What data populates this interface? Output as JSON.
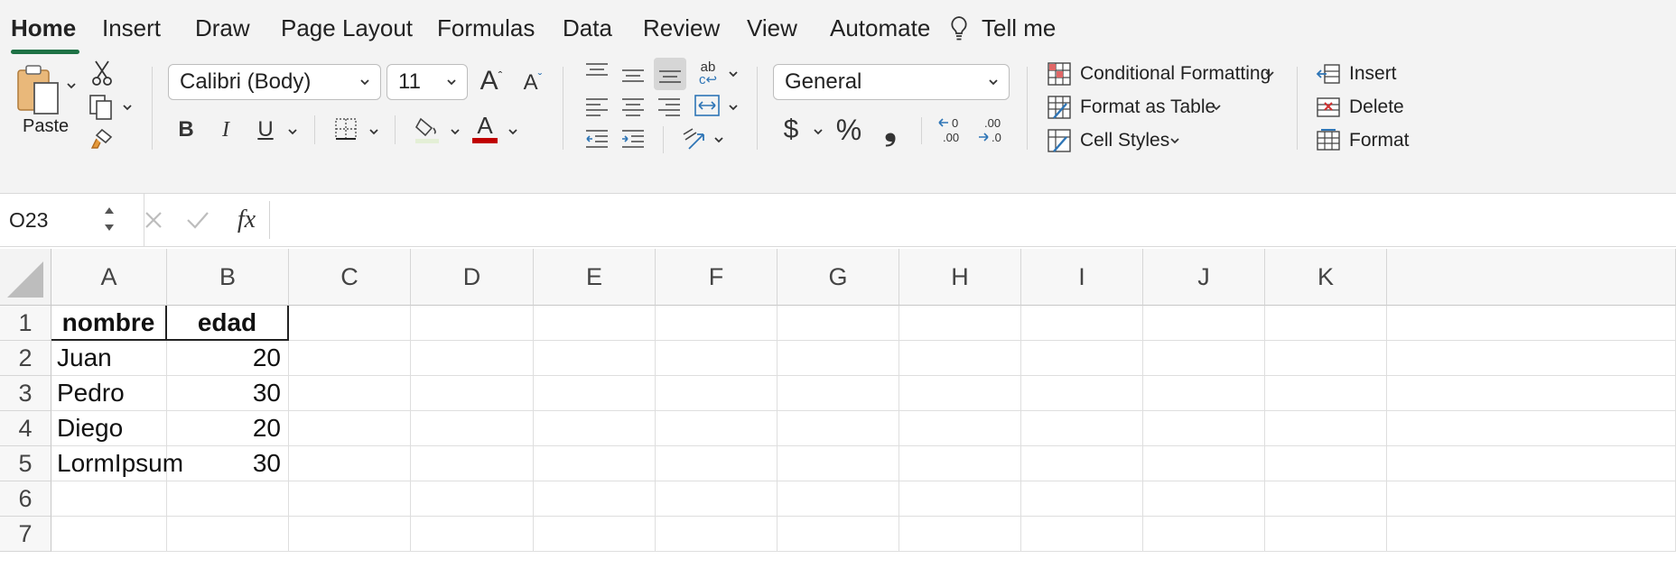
{
  "tabs": [
    {
      "label": "Home",
      "active": true
    },
    {
      "label": "Insert"
    },
    {
      "label": "Draw"
    },
    {
      "label": "Page Layout"
    },
    {
      "label": "Formulas"
    },
    {
      "label": "Data"
    },
    {
      "label": "Review"
    },
    {
      "label": "View"
    },
    {
      "label": "Automate"
    },
    {
      "label": "Tell me"
    }
  ],
  "clipboard": {
    "paste_label": "Paste"
  },
  "font": {
    "name": "Calibri (Body)",
    "size": "11",
    "bold": "B",
    "italic": "I",
    "underline": "U"
  },
  "number": {
    "format": "General",
    "currency": "$",
    "percent": "%",
    "comma": "❟"
  },
  "styles": {
    "conditional_formatting": "Conditional Formatting",
    "format_as_table": "Format as Table",
    "cell_styles": "Cell Styles"
  },
  "cells_group": {
    "insert": "Insert",
    "delete": "Delete",
    "format": "Format"
  },
  "formula_bar": {
    "name_box": "O23",
    "fx": "fx",
    "formula": ""
  },
  "sheet": {
    "columns": [
      "A",
      "B",
      "C",
      "D",
      "E",
      "F",
      "G",
      "H",
      "I",
      "J",
      "K"
    ],
    "rows": [
      "1",
      "2",
      "3",
      "4",
      "5",
      "6",
      "7"
    ],
    "data": [
      [
        "nombre",
        "edad"
      ],
      [
        "Juan",
        "20"
      ],
      [
        "Pedro",
        "30"
      ],
      [
        "Diego",
        "20"
      ],
      [
        "LormIpsum",
        "30"
      ]
    ]
  },
  "colors": {
    "accent": "#1e7145",
    "font_color": "#c00000",
    "icon_blue": "#2e75b6"
  }
}
